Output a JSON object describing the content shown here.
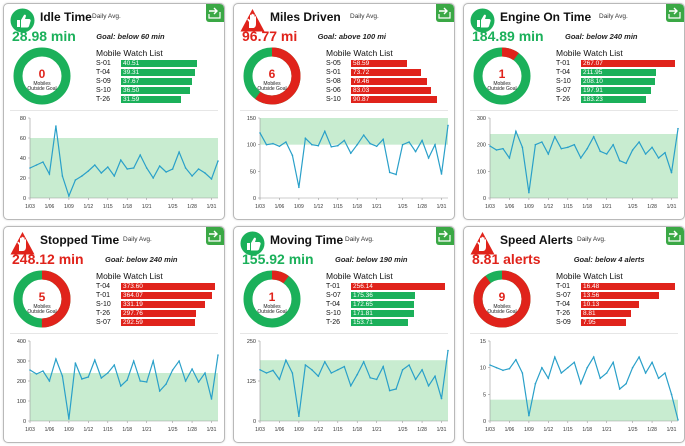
{
  "colors": {
    "good": "#1bb05a",
    "bad": "#e0231b",
    "line": "#2aa0c9",
    "band": "#c8ecd0",
    "corner": "#3aa845"
  },
  "cards": [
    {
      "title": "Idle Time",
      "sub": "Daily Avg.",
      "value": "28.98 min",
      "value_color": "#1bb05a",
      "goal": "Goal: below 60 min",
      "status": "good",
      "donut": {
        "count": "0",
        "label1": "Mobiles",
        "label2": "Outside Goal",
        "fraction": 0
      },
      "watch_title": "Mobile Watch List",
      "watch": [
        {
          "id": "S-01",
          "value": "40.51",
          "color": "#1bb05a",
          "fraction": 0.79
        },
        {
          "id": "T-04",
          "value": "39.31",
          "color": "#1bb05a",
          "fraction": 0.77
        },
        {
          "id": "S-09",
          "value": "37.67",
          "color": "#1bb05a",
          "fraction": 0.74
        },
        {
          "id": "S-10",
          "value": "36.50",
          "color": "#1bb05a",
          "fraction": 0.72
        },
        {
          "id": "T-26",
          "value": "31.59",
          "color": "#1bb05a",
          "fraction": 0.62
        }
      ],
      "chart_data": {
        "type": "line",
        "yticks": [
          "0",
          "20",
          "40",
          "60",
          "80"
        ],
        "ylim": [
          0,
          80
        ],
        "band": [
          0,
          60
        ],
        "x_labels": [
          "1/03",
          "1/06",
          "1/09",
          "1/12",
          "1/15",
          "1/18",
          "1/21",
          "1/25",
          "1/28",
          "1/31"
        ],
        "values": [
          30,
          33,
          36,
          24,
          72,
          22,
          2,
          18,
          22,
          27,
          33,
          25,
          31,
          22,
          38,
          29,
          30,
          43,
          30,
          20,
          32,
          26,
          29,
          46,
          30,
          22,
          29,
          25,
          19,
          37
        ]
      }
    },
    {
      "title": "Miles Driven",
      "sub": "Daily Avg.",
      "value": "96.77 mi",
      "value_color": "#e0231b",
      "goal": "Goal: above 100 mi",
      "status": "bad",
      "donut": {
        "count": "6",
        "label1": "Mobiles",
        "label2": "Outside Goal",
        "fraction": 0.6
      },
      "watch_title": "Mobile Watch List",
      "watch": [
        {
          "id": "S-05",
          "value": "58.59",
          "color": "#e0231b",
          "fraction": 0.58
        },
        {
          "id": "S-01",
          "value": "73.72",
          "color": "#e0231b",
          "fraction": 0.73
        },
        {
          "id": "S-08",
          "value": "79.46",
          "color": "#e0231b",
          "fraction": 0.79
        },
        {
          "id": "S-06",
          "value": "83.03",
          "color": "#e0231b",
          "fraction": 0.83
        },
        {
          "id": "S-10",
          "value": "90.87",
          "color": "#e0231b",
          "fraction": 0.9
        }
      ],
      "chart_data": {
        "type": "line",
        "yticks": [
          "0",
          "50",
          "100",
          "150"
        ],
        "ylim": [
          0,
          150
        ],
        "band": [
          100,
          150
        ],
        "x_labels": [
          "1/03",
          "1/06",
          "1/09",
          "1/12",
          "1/15",
          "1/18",
          "1/21",
          "1/25",
          "1/28",
          "1/31"
        ],
        "values": [
          122,
          100,
          102,
          97,
          105,
          80,
          20,
          112,
          100,
          98,
          125,
          96,
          98,
          108,
          84,
          100,
          118,
          102,
          97,
          110,
          48,
          44,
          100,
          105,
          87,
          108,
          75,
          100,
          45,
          136
        ]
      }
    },
    {
      "title": "Engine On Time",
      "sub": "Daily Avg.",
      "value": "184.89 min",
      "value_color": "#1bb05a",
      "goal": "Goal: below 240 min",
      "status": "good",
      "donut": {
        "count": "1",
        "label1": "Mobiles",
        "label2": "Outside Goal",
        "fraction": 0.1
      },
      "watch_title": "Mobile Watch List",
      "watch": [
        {
          "id": "T-01",
          "value": "267.07",
          "color": "#e0231b",
          "fraction": 0.98
        },
        {
          "id": "T-04",
          "value": "211.95",
          "color": "#1bb05a",
          "fraction": 0.78
        },
        {
          "id": "S-10",
          "value": "208.10",
          "color": "#1bb05a",
          "fraction": 0.77
        },
        {
          "id": "S-07",
          "value": "197.91",
          "color": "#1bb05a",
          "fraction": 0.73
        },
        {
          "id": "T-26",
          "value": "183.23",
          "color": "#1bb05a",
          "fraction": 0.68
        }
      ],
      "chart_data": {
        "type": "line",
        "yticks": [
          "0",
          "100",
          "200",
          "300"
        ],
        "ylim": [
          0,
          300
        ],
        "band": [
          0,
          240
        ],
        "x_labels": [
          "1/03",
          "1/06",
          "1/09",
          "1/12",
          "1/15",
          "1/18",
          "1/21",
          "1/25",
          "1/28",
          "1/31"
        ],
        "values": [
          195,
          180,
          185,
          150,
          250,
          190,
          20,
          200,
          210,
          165,
          230,
          185,
          190,
          200,
          150,
          185,
          230,
          175,
          165,
          200,
          140,
          130,
          180,
          210,
          165,
          190,
          150,
          170,
          95,
          260
        ]
      }
    },
    {
      "title": "Stopped Time",
      "sub": "Daily Avg.",
      "value": "248.12 min",
      "value_color": "#e0231b",
      "goal": "Goal: below 240 min",
      "status": "bad",
      "donut": {
        "count": "5",
        "label1": "Mobiles",
        "label2": "Outside Goal",
        "fraction": 0.5
      },
      "watch_title": "Mobile Watch List",
      "watch": [
        {
          "id": "T-04",
          "value": "373.60",
          "color": "#e0231b",
          "fraction": 0.98
        },
        {
          "id": "T-01",
          "value": "364.07",
          "color": "#e0231b",
          "fraction": 0.95
        },
        {
          "id": "S-10",
          "value": "331.19",
          "color": "#e0231b",
          "fraction": 0.87
        },
        {
          "id": "T-26",
          "value": "297.76",
          "color": "#e0231b",
          "fraction": 0.78
        },
        {
          "id": "S-07",
          "value": "292.59",
          "color": "#e0231b",
          "fraction": 0.77
        }
      ],
      "chart_data": {
        "type": "line",
        "yticks": [
          "0",
          "100",
          "200",
          "300",
          "400"
        ],
        "ylim": [
          0,
          400
        ],
        "band": [
          0,
          240
        ],
        "x_labels": [
          "1/03",
          "1/06",
          "1/09",
          "1/12",
          "1/15",
          "1/18",
          "1/21",
          "1/25",
          "1/28",
          "1/31"
        ],
        "values": [
          255,
          235,
          250,
          200,
          310,
          225,
          10,
          290,
          210,
          220,
          305,
          215,
          240,
          280,
          175,
          205,
          300,
          200,
          195,
          300,
          150,
          185,
          255,
          300,
          200,
          260,
          195,
          240,
          110,
          330
        ]
      }
    },
    {
      "title": "Moving Time",
      "sub": "Daily Avg.",
      "value": "155.92 min",
      "value_color": "#1bb05a",
      "goal": "Goal: below 190 min",
      "status": "good",
      "donut": {
        "count": "1",
        "label1": "Mobiles",
        "label2": "Outside Goal",
        "fraction": 0.1
      },
      "watch_title": "Mobile Watch List",
      "watch": [
        {
          "id": "T-01",
          "value": "256.14",
          "color": "#e0231b",
          "fraction": 0.98
        },
        {
          "id": "S-07",
          "value": "175.36",
          "color": "#1bb05a",
          "fraction": 0.67
        },
        {
          "id": "T-04",
          "value": "172.65",
          "color": "#1bb05a",
          "fraction": 0.66
        },
        {
          "id": "S-10",
          "value": "171.81",
          "color": "#1bb05a",
          "fraction": 0.66
        },
        {
          "id": "T-26",
          "value": "153.71",
          "color": "#1bb05a",
          "fraction": 0.59
        }
      ],
      "chart_data": {
        "type": "line",
        "yticks": [
          "0",
          "125",
          "250"
        ],
        "ylim": [
          0,
          250
        ],
        "band": [
          0,
          190
        ],
        "x_labels": [
          "1/03",
          "1/06",
          "1/09",
          "1/12",
          "1/15",
          "1/18",
          "1/21",
          "1/25",
          "1/28",
          "1/31"
        ],
        "values": [
          160,
          150,
          158,
          130,
          190,
          150,
          15,
          175,
          160,
          140,
          185,
          150,
          160,
          170,
          110,
          145,
          185,
          135,
          130,
          170,
          95,
          100,
          160,
          175,
          130,
          160,
          110,
          140,
          70,
          220
        ]
      }
    },
    {
      "title": "Speed Alerts",
      "sub": "Daily Avg.",
      "value": "8.81 alerts",
      "value_color": "#e0231b",
      "goal": "Goal: below 4 alerts",
      "status": "bad",
      "donut": {
        "count": "9",
        "label1": "Mobiles",
        "label2": "Outside Goal",
        "fraction": 0.9
      },
      "watch_title": "Mobile Watch List",
      "watch": [
        {
          "id": "T-01",
          "value": "16.48",
          "color": "#e0231b",
          "fraction": 0.98
        },
        {
          "id": "S-07",
          "value": "13.56",
          "color": "#e0231b",
          "fraction": 0.81
        },
        {
          "id": "T-04",
          "value": "10.13",
          "color": "#e0231b",
          "fraction": 0.6
        },
        {
          "id": "T-26",
          "value": "8.81",
          "color": "#e0231b",
          "fraction": 0.52
        },
        {
          "id": "S-09",
          "value": "7.95",
          "color": "#e0231b",
          "fraction": 0.47
        }
      ],
      "chart_data": {
        "type": "line",
        "yticks": [
          "0",
          "5",
          "10",
          "15"
        ],
        "ylim": [
          0,
          15
        ],
        "band": [
          0,
          4
        ],
        "x_labels": [
          "1/03",
          "1/06",
          "1/09",
          "1/12",
          "1/15",
          "1/18",
          "1/21",
          "1/25",
          "1/28",
          "1/31"
        ],
        "values": [
          10.5,
          10,
          9.5,
          9.8,
          11.5,
          9,
          1,
          7,
          10,
          8,
          12,
          9,
          10,
          11,
          7,
          10,
          12,
          8,
          9,
          11,
          6,
          7,
          10,
          12,
          9,
          11,
          8,
          9,
          5,
          0.2
        ]
      }
    }
  ]
}
